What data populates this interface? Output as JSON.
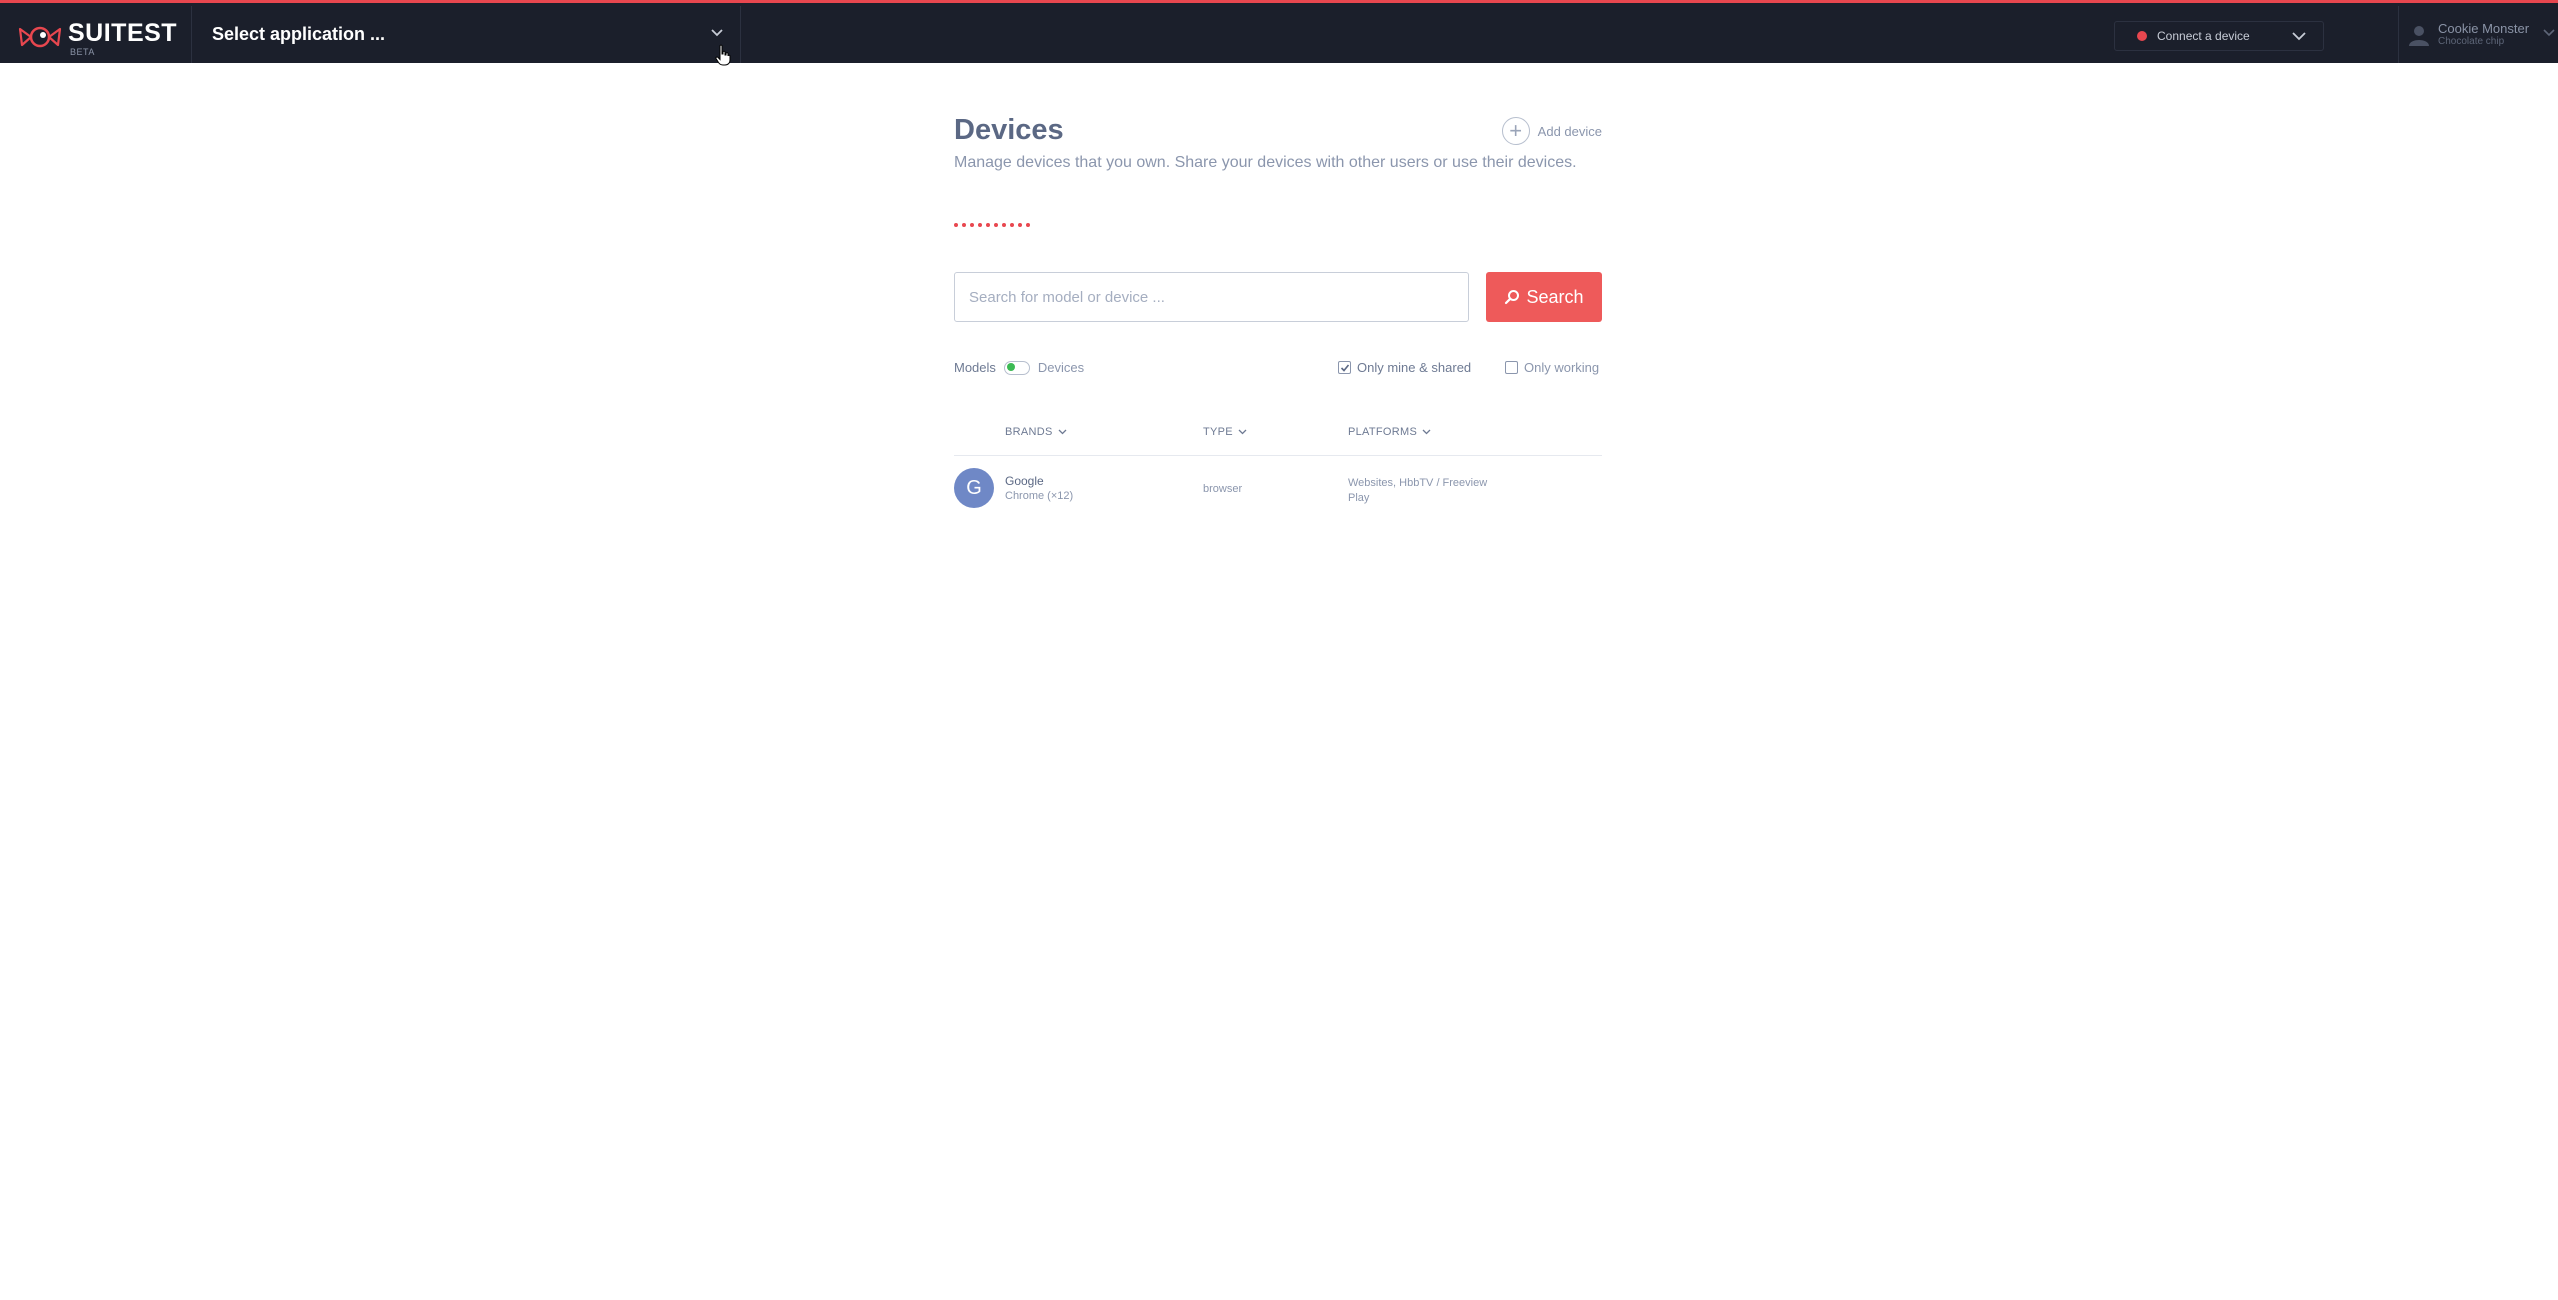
{
  "header": {
    "logo_text": "SUITEST",
    "logo_badge": "BETA",
    "app_select_label": "Select application ...",
    "connect_label": "Connect a device",
    "connect_status_color": "#e8474f",
    "user_name": "Cookie Monster",
    "user_org": "Chocolate chip",
    "accent_color": "#e8474f"
  },
  "page": {
    "title": "Devices",
    "description": "Manage devices that you own. Share your devices with other users or use their devices.",
    "add_device_label": "Add device"
  },
  "search": {
    "placeholder": "Search for model or device ...",
    "value": "",
    "button_label": "Search"
  },
  "filters": {
    "toggle_left": "Models",
    "toggle_right": "Devices",
    "only_mine_label": "Only mine & shared",
    "only_mine_checked": true,
    "only_working_label": "Only working",
    "only_working_checked": false
  },
  "table": {
    "columns": [
      "BRANDS",
      "TYPE",
      "PLATFORMS"
    ],
    "rows": [
      {
        "avatar_letter": "G",
        "brand": "Google",
        "model": "Chrome (×12)",
        "type": "browser",
        "platforms": "Websites, HbbTV / Freeview Play"
      }
    ]
  }
}
